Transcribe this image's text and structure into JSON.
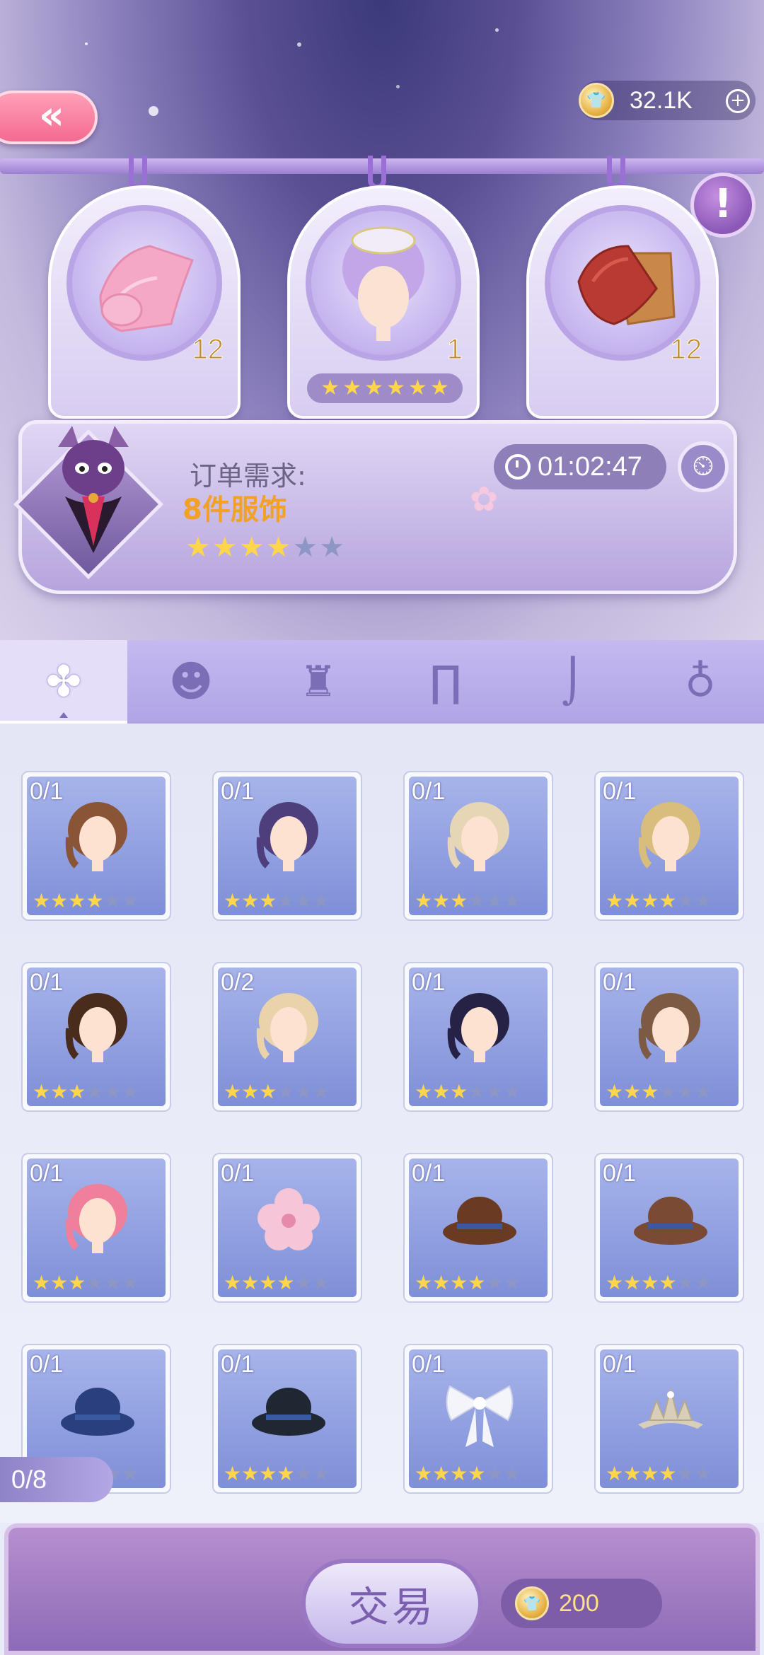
{
  "header": {
    "coins": "32.1K",
    "back_glyph": "«",
    "plus_glyph": "+",
    "info_glyph": "!"
  },
  "materials": [
    {
      "name": "pink-fabric",
      "count": "12"
    },
    {
      "name": "lavender-hair",
      "count": "1",
      "stars": 6
    },
    {
      "name": "red-brown-fabric",
      "count": "12"
    }
  ],
  "order": {
    "label": "订单需求:",
    "requirement": "8件服饰",
    "stars_filled": 4,
    "stars_total": 6,
    "timer": "01:02:47"
  },
  "tabs": [
    {
      "id": "all",
      "icon": "clover-icon",
      "glyph": "✤"
    },
    {
      "id": "hair",
      "icon": "hair-icon",
      "glyph": "☻"
    },
    {
      "id": "top",
      "icon": "top-icon",
      "glyph": "♜"
    },
    {
      "id": "bottom",
      "icon": "pants-icon",
      "glyph": "∏"
    },
    {
      "id": "shoes",
      "icon": "foot-icon",
      "glyph": "⌡"
    },
    {
      "id": "accessory",
      "icon": "bag-icon",
      "glyph": "♁"
    }
  ],
  "items": [
    {
      "qty": "0/1",
      "kind": "hair",
      "color": "#8a5436",
      "stars": 4
    },
    {
      "qty": "0/1",
      "kind": "hair",
      "color": "#4e3f7c",
      "stars": 3
    },
    {
      "qty": "0/1",
      "kind": "hair",
      "color": "#e7d6b6",
      "stars": 3
    },
    {
      "qty": "0/1",
      "kind": "hair",
      "color": "#d9bd7c",
      "stars": 4
    },
    {
      "qty": "0/1",
      "kind": "hair",
      "color": "#4a2c1c",
      "stars": 3
    },
    {
      "qty": "0/2",
      "kind": "hair",
      "color": "#ead3aa",
      "stars": 3
    },
    {
      "qty": "0/1",
      "kind": "hair",
      "color": "#262246",
      "stars": 3
    },
    {
      "qty": "0/1",
      "kind": "hair",
      "color": "#7c5a44",
      "stars": 3
    },
    {
      "qty": "0/1",
      "kind": "hair",
      "color": "#ef7f9a",
      "stars": 3
    },
    {
      "qty": "0/1",
      "kind": "flower",
      "color": "#f6c6d8",
      "stars": 4
    },
    {
      "qty": "0/1",
      "kind": "hat",
      "color": "#6a3b22",
      "stars": 4
    },
    {
      "qty": "0/1",
      "kind": "hat",
      "color": "#7a4a34",
      "stars": 4
    },
    {
      "qty": "0/1",
      "kind": "hat",
      "color": "#2a3f7e",
      "stars": 3
    },
    {
      "qty": "0/1",
      "kind": "hat",
      "color": "#1f2733",
      "stars": 4
    },
    {
      "qty": "0/1",
      "kind": "bow",
      "color": "#f4f4fb",
      "stars": 4
    },
    {
      "qty": "0/1",
      "kind": "tiara",
      "color": "#d9cfb9",
      "stars": 4
    }
  ],
  "progress": "0/8",
  "trade": {
    "label": "交易",
    "price": "200"
  }
}
